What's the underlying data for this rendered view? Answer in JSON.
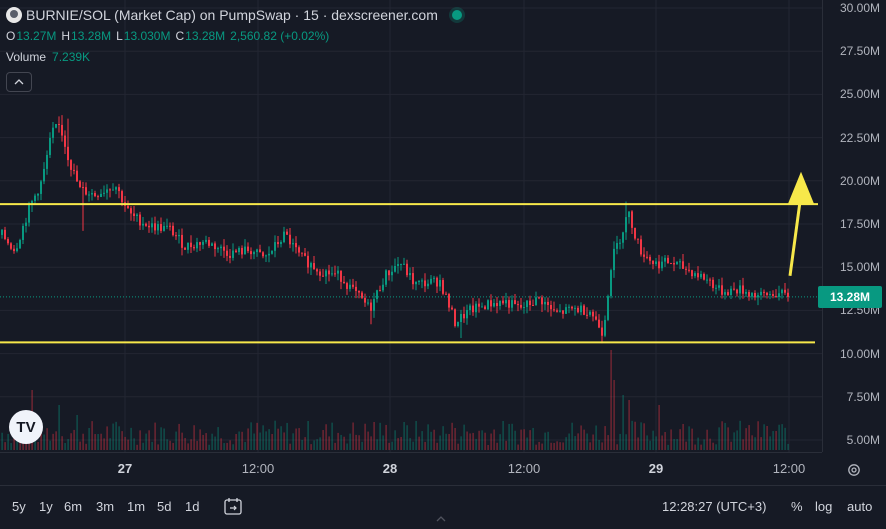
{
  "header": {
    "title": "BURNIE/SOL (Market Cap) on PumpSwap · 15 · dexscreener.com",
    "ohlc": [
      {
        "key": "O",
        "value": "13.27M"
      },
      {
        "key": "H",
        "value": "13.28M"
      },
      {
        "key": "L",
        "value": "13.030M"
      },
      {
        "key": "C",
        "value": "13.28M"
      }
    ],
    "change": "2,560.82 (+0.02%)",
    "volume_label": "Volume",
    "volume_value": "7.239K"
  },
  "colors": {
    "background": "#161a25",
    "up": "#089981",
    "down": "#f23645",
    "annotation": "#f7e84a",
    "grid": "#232632"
  },
  "price_scale": {
    "ticks": [
      "30.00M",
      "27.50M",
      "25.00M",
      "22.50M",
      "20.00M",
      "17.50M",
      "15.00M",
      "12.50M",
      "10.00M",
      "7.50M",
      "5.00M"
    ],
    "last_price": "13.28M"
  },
  "time_axis": {
    "ticks": [
      {
        "label": "27",
        "bold": true
      },
      {
        "label": "12:00",
        "bold": false
      },
      {
        "label": "28",
        "bold": true
      },
      {
        "label": "12:00",
        "bold": false
      },
      {
        "label": "29",
        "bold": true
      },
      {
        "label": "12:00",
        "bold": false
      }
    ]
  },
  "bottom_bar": {
    "ranges": [
      "5y",
      "1y",
      "6m",
      "3m",
      "1m",
      "5d",
      "1d"
    ],
    "clock": "12:28:27 (UTC+3)",
    "percent_label": "%",
    "log_label": "log",
    "auto_label": "auto"
  },
  "logo_text": "TV",
  "icons": {
    "calendar": "calendar-range-icon",
    "settings": "gear-icon",
    "collapse": "chevron-up-icon",
    "scroll": "chevron-up-small-icon"
  },
  "chart_data": {
    "type": "candlestick",
    "symbol": "BURNIE/SOL",
    "interval": "15",
    "ylim": [
      4.0,
      30.0
    ],
    "yunit": "M",
    "last_value": 13.28,
    "waypoints": [
      [
        0,
        17.0
      ],
      [
        15,
        16.0
      ],
      [
        30,
        18.5
      ],
      [
        42,
        20.0
      ],
      [
        52,
        22.8
      ],
      [
        60,
        23.2
      ],
      [
        70,
        21.0
      ],
      [
        80,
        19.5
      ],
      [
        95,
        19.2
      ],
      [
        115,
        19.8
      ],
      [
        130,
        18.0
      ],
      [
        150,
        17.4
      ],
      [
        170,
        17.2
      ],
      [
        185,
        16.2
      ],
      [
        205,
        16.5
      ],
      [
        230,
        15.8
      ],
      [
        250,
        16.0
      ],
      [
        265,
        15.5
      ],
      [
        285,
        16.9
      ],
      [
        300,
        15.6
      ],
      [
        320,
        14.8
      ],
      [
        340,
        14.5
      ],
      [
        355,
        13.5
      ],
      [
        370,
        12.6
      ],
      [
        385,
        14.5
      ],
      [
        400,
        15.3
      ],
      [
        415,
        14.0
      ],
      [
        440,
        14.2
      ],
      [
        455,
        11.8
      ],
      [
        470,
        12.5
      ],
      [
        490,
        12.9
      ],
      [
        505,
        13.0
      ],
      [
        520,
        12.6
      ],
      [
        540,
        13.2
      ],
      [
        555,
        12.3
      ],
      [
        575,
        12.6
      ],
      [
        590,
        12.5
      ],
      [
        603,
        11.2
      ],
      [
        612,
        15.5
      ],
      [
        622,
        17.0
      ],
      [
        628,
        18.2
      ],
      [
        640,
        16.0
      ],
      [
        655,
        15.2
      ],
      [
        670,
        15.3
      ],
      [
        690,
        14.8
      ],
      [
        710,
        14.2
      ],
      [
        720,
        13.6
      ],
      [
        740,
        13.7
      ],
      [
        760,
        13.3
      ],
      [
        775,
        13.5
      ],
      [
        790,
        13.28
      ]
    ],
    "spikes": [
      {
        "x": 62,
        "high": 23.8
      },
      {
        "x": 68,
        "high": 23.6
      },
      {
        "x": 627,
        "high": 18.8
      },
      {
        "x": 603,
        "low": 10.6
      },
      {
        "x": 461,
        "low": 10.9
      },
      {
        "x": 83,
        "low": 17.1
      },
      {
        "x": 372,
        "low": 11.7
      }
    ],
    "volume_bars": [
      {
        "x": 32,
        "v": 0.6
      },
      {
        "x": 58,
        "v": 0.45
      },
      {
        "x": 78,
        "v": 0.35
      },
      {
        "x": 610,
        "v": 1.0
      },
      {
        "x": 615,
        "v": 0.7
      },
      {
        "x": 622,
        "v": 0.55
      },
      {
        "x": 628,
        "v": 0.5
      },
      {
        "x": 660,
        "v": 0.45
      },
      {
        "x": 375,
        "v": 0.28
      },
      {
        "x": 455,
        "v": 0.22
      }
    ],
    "annotations": {
      "resistance": 18.65,
      "support": 10.65,
      "arrow_from": 14.5,
      "arrow_to": 19.6
    }
  }
}
